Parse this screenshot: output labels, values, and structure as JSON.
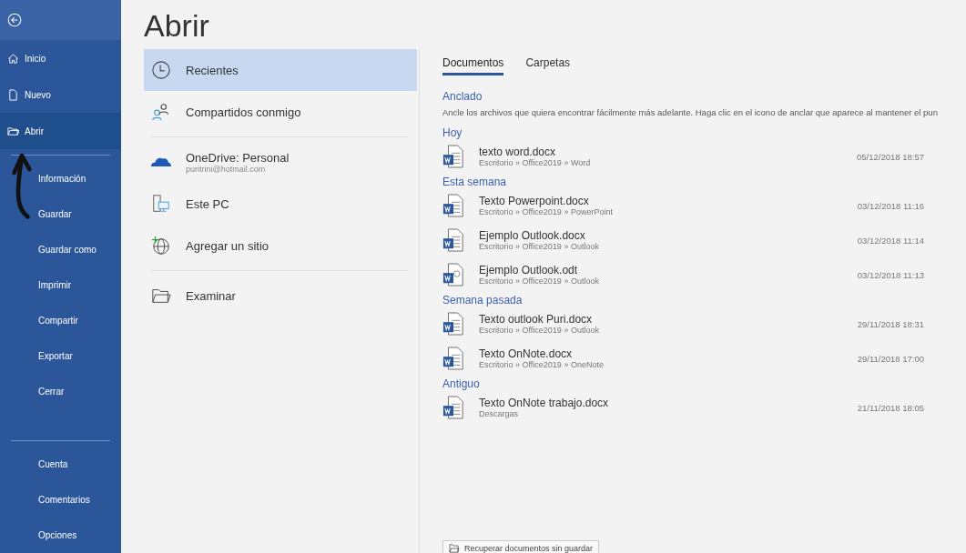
{
  "sidebar": {
    "top_items": [
      {
        "label": "Inicio",
        "selected": false
      },
      {
        "label": "Nuevo",
        "selected": false
      },
      {
        "label": "Abrir",
        "selected": true
      }
    ],
    "middle_items": [
      "Información",
      "Guardar",
      "Guardar como",
      "Imprimir",
      "Compartir",
      "Exportar",
      "Cerrar"
    ],
    "bottom_items": [
      "Cuenta",
      "Comentarios",
      "Opciones"
    ]
  },
  "title": "Abrir",
  "locations": [
    {
      "label": "Recientes",
      "selected": true
    },
    {
      "label": "Compartidos conmigo",
      "selected": false,
      "divider_after": true
    },
    {
      "label": "OneDrive: Personal",
      "sublabel": "puritrini@hotmail.com",
      "selected": false
    },
    {
      "label": "Este PC",
      "selected": false
    },
    {
      "label": "Agregar un sitio",
      "selected": false,
      "divider_after": true
    },
    {
      "label": "Examinar",
      "selected": false
    }
  ],
  "tabs": [
    {
      "label": "Documentos",
      "selected": true
    },
    {
      "label": "Carpetas",
      "selected": false
    }
  ],
  "pinned": {
    "heading": "Anclado",
    "text": "Ancle los archivos que quiera encontrar fácilmente más adelante. Haga clic en el icono de anclar que aparece al mantener el pun"
  },
  "groups": [
    {
      "heading": "Hoy",
      "files": [
        {
          "name": "texto word.docx",
          "path": "Escritorio » Office2019 » Word",
          "date": "05/12/2018 18:57",
          "kind": "docx"
        }
      ]
    },
    {
      "heading": "Esta semana",
      "files": [
        {
          "name": "Texto Powerpoint.docx",
          "path": "Escritorio » Office2019 » PowerPoint",
          "date": "03/12/2018 11:16",
          "kind": "docx"
        },
        {
          "name": "Ejemplo Outlook.docx",
          "path": "Escritorio » Office2019 » Outlook",
          "date": "03/12/2018 11:14",
          "kind": "docx"
        },
        {
          "name": "Ejemplo Outlook.odt",
          "path": "Escritorio » Office2019 » Outlook",
          "date": "03/12/2018 11:13",
          "kind": "odt"
        }
      ]
    },
    {
      "heading": "Semana pasada",
      "files": [
        {
          "name": "Texto outlook Puri.docx",
          "path": "Escritorio » Office2019 » Outlook",
          "date": "29/11/2018 18:31",
          "kind": "docx"
        },
        {
          "name": "Texto OnNote.docx",
          "path": "Escritorio » Office2019 » OneNote",
          "date": "29/11/2018 17:00",
          "kind": "docx"
        }
      ]
    },
    {
      "heading": "Antiguo",
      "files": [
        {
          "name": "Texto OnNote trabajo.docx",
          "path": "Descargas",
          "date": "21/11/2018 18:05",
          "kind": "docx"
        }
      ]
    }
  ],
  "recover_button": "Recuperar documentos sin guardar"
}
